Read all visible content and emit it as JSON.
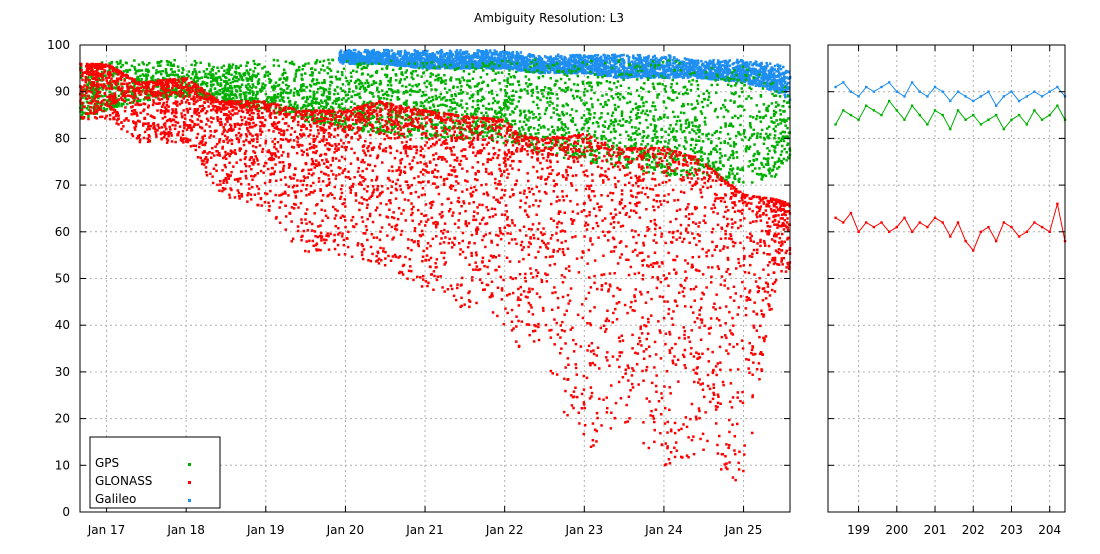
{
  "chart_data": [
    {
      "type": "scatter",
      "title": "Ambiguity Resolution: L3",
      "xlabel": "",
      "ylabel": "",
      "ylim": [
        0,
        100
      ],
      "yticks": [
        0,
        10,
        20,
        30,
        40,
        50,
        60,
        70,
        80,
        90,
        100
      ],
      "xrange": [
        "2016-09",
        "2025-08"
      ],
      "xtick_labels": [
        "Jan 17",
        "Jan 18",
        "Jan 19",
        "Jan 20",
        "Jan 21",
        "Jan 22",
        "Jan 23",
        "Jan 24",
        "Jan 25"
      ],
      "grid": true,
      "legend_position": "bottom-left",
      "series": [
        {
          "name": "GPS",
          "color": "#00b000",
          "x": [
            "2016-09",
            "2017-01",
            "2017-06",
            "2018-01",
            "2018-06",
            "2019-01",
            "2019-06",
            "2020-01",
            "2020-06",
            "2021-01",
            "2021-06",
            "2022-01",
            "2022-06",
            "2023-01",
            "2023-06",
            "2024-01",
            "2024-06",
            "2025-01",
            "2025-06",
            "2025-08"
          ],
          "y_high": [
            96,
            97,
            97,
            97,
            96,
            97,
            97,
            97,
            97,
            97,
            97,
            97,
            97,
            97,
            97,
            97,
            96,
            96,
            92,
            91
          ],
          "y_low": [
            84,
            86,
            88,
            89,
            88,
            86,
            84,
            82,
            81,
            80,
            80,
            79,
            77,
            75,
            74,
            72,
            72,
            70,
            72,
            76
          ]
        },
        {
          "name": "GLONASS",
          "color": "#ff0000",
          "x": [
            "2016-09",
            "2017-01",
            "2017-06",
            "2018-01",
            "2018-06",
            "2019-01",
            "2019-06",
            "2020-01",
            "2020-06",
            "2021-01",
            "2021-06",
            "2022-01",
            "2022-03",
            "2022-06",
            "2023-01",
            "2023-06",
            "2024-01",
            "2024-06",
            "2025-01",
            "2025-06",
            "2025-08"
          ],
          "y_high": [
            96,
            96,
            92,
            93,
            88,
            88,
            86,
            86,
            88,
            86,
            85,
            84,
            81,
            80,
            81,
            78,
            78,
            76,
            68,
            67,
            66
          ],
          "y_low": [
            84,
            84,
            79,
            79,
            68,
            65,
            56,
            55,
            52,
            48,
            44,
            40,
            30,
            36,
            10,
            20,
            9,
            12,
            5,
            50,
            52
          ]
        },
        {
          "name": "Galileo",
          "color": "#1e8ff0",
          "x": [
            "2019-12",
            "2020-06",
            "2021-01",
            "2021-06",
            "2022-01",
            "2022-06",
            "2023-01",
            "2023-06",
            "2024-01",
            "2024-06",
            "2025-01",
            "2025-06",
            "2025-08"
          ],
          "y_high": [
            99,
            99,
            99,
            99,
            99,
            98,
            98,
            98,
            98,
            97,
            97,
            96,
            95
          ],
          "y_low": [
            96,
            96,
            95,
            95,
            95,
            94,
            94,
            93,
            93,
            93,
            92,
            90,
            88
          ]
        }
      ]
    },
    {
      "type": "line",
      "title": "",
      "xlabel": "",
      "ylabel": "",
      "ylim": [
        0,
        100
      ],
      "xlim": [
        198.2,
        204.4
      ],
      "xticks": [
        199,
        200,
        201,
        202,
        203,
        204
      ],
      "grid": true,
      "series": [
        {
          "name": "GPS",
          "color": "#00b000",
          "x": [
            198.4,
            198.6,
            198.8,
            199.0,
            199.2,
            199.4,
            199.6,
            199.8,
            200.0,
            200.2,
            200.4,
            200.6,
            200.8,
            201.0,
            201.2,
            201.4,
            201.6,
            201.8,
            202.0,
            202.2,
            202.4,
            202.6,
            202.8,
            203.0,
            203.2,
            203.4,
            203.6,
            203.8,
            204.0,
            204.2,
            204.4
          ],
          "y": [
            83,
            86,
            85,
            84,
            87,
            86,
            85,
            88,
            86,
            84,
            87,
            85,
            83,
            86,
            85,
            82,
            86,
            84,
            85,
            83,
            84,
            85,
            82,
            84,
            85,
            83,
            86,
            84,
            85,
            87,
            84
          ]
        },
        {
          "name": "GLONASS",
          "color": "#ff0000",
          "x": [
            198.4,
            198.6,
            198.8,
            199.0,
            199.2,
            199.4,
            199.6,
            199.8,
            200.0,
            200.2,
            200.4,
            200.6,
            200.8,
            201.0,
            201.2,
            201.4,
            201.6,
            201.8,
            202.0,
            202.2,
            202.4,
            202.6,
            202.8,
            203.0,
            203.2,
            203.4,
            203.6,
            203.8,
            204.0,
            204.2,
            204.4
          ],
          "y": [
            63,
            62,
            64,
            60,
            62,
            61,
            62,
            60,
            61,
            63,
            60,
            62,
            61,
            63,
            62,
            59,
            62,
            58,
            56,
            60,
            61,
            58,
            62,
            61,
            59,
            60,
            62,
            61,
            60,
            66,
            58
          ]
        },
        {
          "name": "Galileo",
          "color": "#1e8ff0",
          "x": [
            198.4,
            198.6,
            198.8,
            199.0,
            199.2,
            199.4,
            199.6,
            199.8,
            200.0,
            200.2,
            200.4,
            200.6,
            200.8,
            201.0,
            201.2,
            201.4,
            201.6,
            201.8,
            202.0,
            202.2,
            202.4,
            202.6,
            202.8,
            203.0,
            203.2,
            203.4,
            203.6,
            203.8,
            204.0,
            204.2,
            204.4
          ],
          "y": [
            91,
            92,
            90,
            89,
            91,
            90,
            91,
            92,
            90,
            89,
            92,
            90,
            89,
            91,
            90,
            88,
            90,
            89,
            88,
            89,
            90,
            87,
            89,
            90,
            88,
            89,
            90,
            89,
            90,
            91,
            89
          ]
        }
      ]
    }
  ]
}
